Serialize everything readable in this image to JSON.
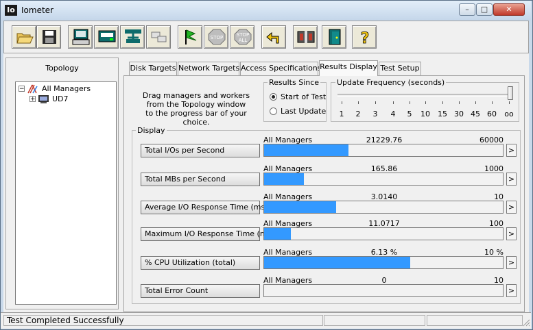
{
  "window": {
    "title": "Iometer",
    "app_icon": "Io",
    "minimize": "–",
    "maximize": "□",
    "close": "✕"
  },
  "toolbar": {
    "buttons": [
      {
        "name": "open-config-button",
        "icon": "folder-open-icon"
      },
      {
        "name": "save-config-button",
        "icon": "floppy-disk-icon"
      },
      {
        "name": "start-disk-worker-button",
        "icon": "disk-worker-icon"
      },
      {
        "name": "start-network-worker-button",
        "icon": "network-worker-icon"
      },
      {
        "name": "duplicate-worker-button",
        "icon": "duplicate-worker-icon"
      },
      {
        "name": "disconnect-worker-button",
        "icon": "disconnect-icon"
      },
      {
        "name": "start-tests-button",
        "icon": "green-flag-icon"
      },
      {
        "name": "stop-button",
        "icon": "stop-sign-icon",
        "label": "STOP"
      },
      {
        "name": "stop-all-button",
        "icon": "stop-all-sign-icon",
        "label": "STOP",
        "label2": "ALL"
      },
      {
        "name": "reset-workers-button",
        "icon": "reset-arrow-icon"
      },
      {
        "name": "new-manager-button",
        "icon": "computer-manager-icon"
      },
      {
        "name": "exit-button",
        "icon": "exit-door-icon"
      },
      {
        "name": "about-button",
        "icon": "question-mark-icon",
        "label": "?"
      }
    ]
  },
  "topology": {
    "title": "Topology",
    "root": {
      "label": "All Managers",
      "expander": "−"
    },
    "child": {
      "label": "UD7",
      "expander": "+"
    }
  },
  "tabs": [
    {
      "label": "Disk Targets",
      "active": false
    },
    {
      "label": "Network Targets",
      "active": false
    },
    {
      "label": "Access Specifications",
      "active": false
    },
    {
      "label": "Results Display",
      "active": true
    },
    {
      "label": "Test Setup",
      "active": false
    }
  ],
  "results_display": {
    "instructions": [
      "Drag managers and workers",
      "from the Topology window",
      "to the progress bar of your choice."
    ],
    "results_since": {
      "label": "Results Since",
      "options": [
        {
          "label": "Start of Test",
          "selected": true
        },
        {
          "label": "Last Update",
          "selected": false
        }
      ]
    },
    "update_frequency": {
      "label": "Update Frequency (seconds)",
      "ticks": [
        "1",
        "2",
        "3",
        "4",
        "5",
        "10",
        "15",
        "30",
        "45",
        "60",
        "oo"
      ],
      "selected": "oo"
    },
    "display_label": "Display",
    "metrics": [
      {
        "name": "Total I/Os per Second",
        "source": "All Managers",
        "value": "21229.76",
        "max": "60000",
        "fraction": 0.354
      },
      {
        "name": "Total MBs per Second",
        "source": "All Managers",
        "value": "165.86",
        "max": "1000",
        "fraction": 0.166
      },
      {
        "name": "Average I/O Response Time (ms)",
        "source": "All Managers",
        "value": "3.0140",
        "max": "10",
        "fraction": 0.301
      },
      {
        "name": "Maximum I/O Response Time (ms)",
        "source": "All Managers",
        "value": "11.0717",
        "max": "100",
        "fraction": 0.111
      },
      {
        "name": "% CPU Utilization (total)",
        "source": "All Managers",
        "value": "6.13 %",
        "max": "10 %",
        "fraction": 0.613
      },
      {
        "name": "Total Error Count",
        "source": "All Managers",
        "value": "0",
        "max": "10",
        "fraction": 0
      }
    ],
    "nav_glyph": ">"
  },
  "status": {
    "text": "Test Completed Successfully"
  },
  "colors": {
    "bar_fill": "#3399ff",
    "window_frame": "#c9d9ea",
    "panel": "#f0f0f0"
  }
}
